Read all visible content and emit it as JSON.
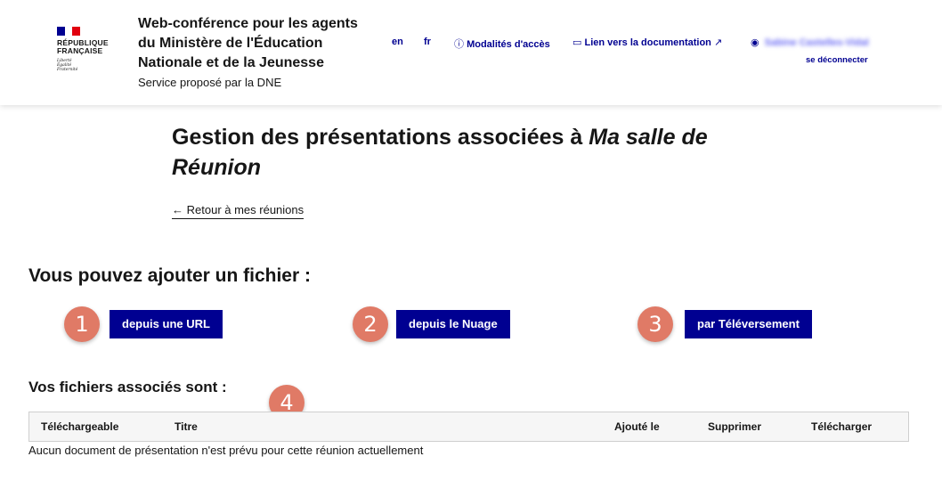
{
  "header": {
    "logo_lines": [
      "RÉPUBLIQUE",
      "FRANÇAISE"
    ],
    "motto": [
      "Liberté",
      "Égalité",
      "Fraternité"
    ],
    "service_title": "Web-conférence pour les agents du Ministère de l'Éducation Nationale et de la Jeunesse",
    "service_tagline": "Service proposé par la DNE",
    "lang_en": "en",
    "lang_fr": "fr",
    "access_link": "Modalités d'accès",
    "doc_link": "Lien vers la documentation",
    "user_name": "Sabine Castelles-Vidal",
    "logout": "se déconnecter"
  },
  "page": {
    "title_prefix": "Gestion des présentations associées à ",
    "title_room": "Ma salle de Réunion",
    "back_link": "Retour à mes réunions"
  },
  "add": {
    "heading": "Vous pouvez ajouter un fichier :",
    "url_button": "depuis une URL",
    "cloud_button": "depuis le Nuage",
    "upload_button": "par Téléversement"
  },
  "files": {
    "heading": "Vos fichiers associés sont :",
    "columns": [
      "Téléchargeable",
      "Titre",
      "Ajouté le",
      "Supprimer",
      "Télécharger"
    ],
    "empty_message": "Aucun document de présentation n'est prévu pour cette réunion actuellement"
  },
  "annotations": [
    "1",
    "2",
    "3",
    "4"
  ],
  "colors": {
    "primary": "#000091",
    "flag_red": "#e1000f",
    "annotation": "#e07a66"
  }
}
